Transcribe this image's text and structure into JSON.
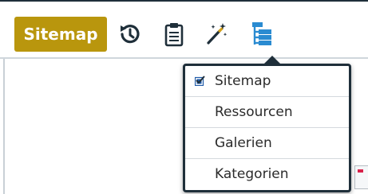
{
  "toolbar": {
    "sitemap_label": "Sitemap",
    "icons": [
      "history-icon",
      "clipboard-icon",
      "magic-wand-icon",
      "sitemap-tree-icon"
    ]
  },
  "dropdown": {
    "items": [
      {
        "label": "Sitemap",
        "checked": true
      },
      {
        "label": "Ressourcen",
        "checked": false
      },
      {
        "label": "Galerien",
        "checked": false
      },
      {
        "label": "Kategorien",
        "checked": false
      }
    ]
  },
  "colors": {
    "accent": "#b9960d",
    "icon": "#1f2f3a",
    "active_icon": "#2a8bd1",
    "frame": "#1f2f3a",
    "check": "#1e5aa8"
  }
}
